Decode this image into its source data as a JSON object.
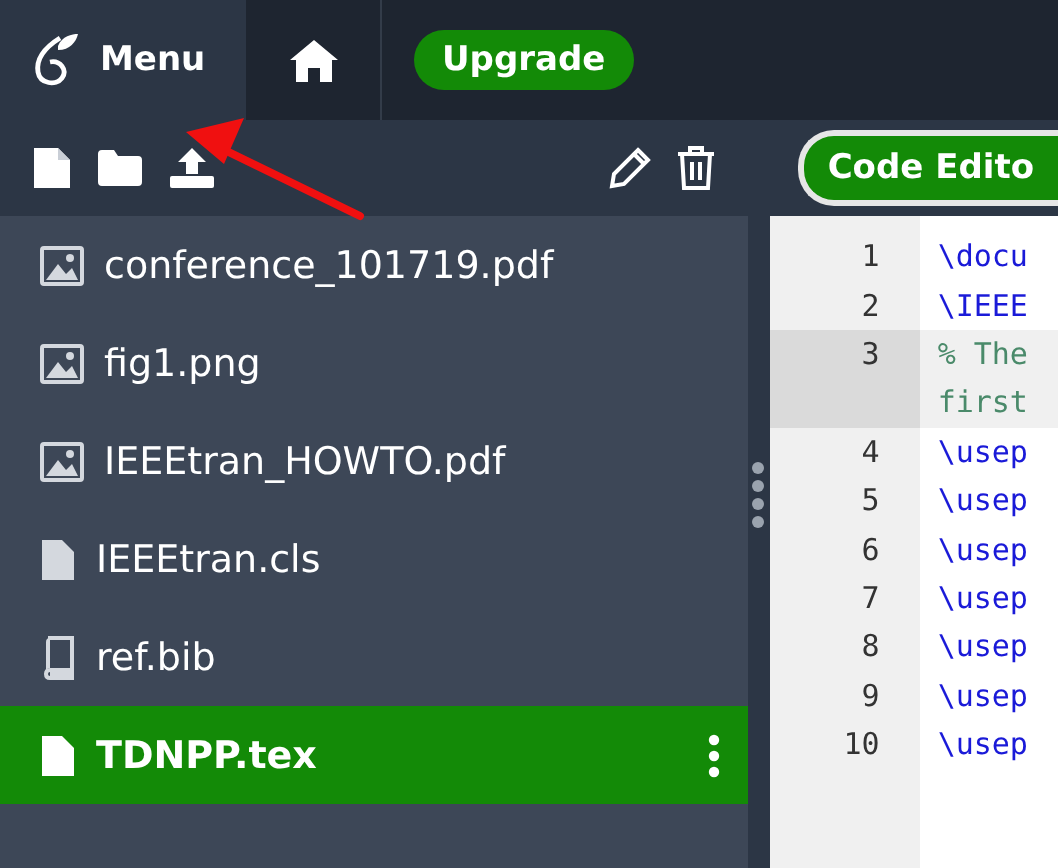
{
  "topbar": {
    "menu_label": "Menu",
    "upgrade_label": "Upgrade"
  },
  "editor_tab": {
    "label": "Code Edito"
  },
  "files": [
    {
      "name": "conference_101719.pdf",
      "kind": "image",
      "selected": false
    },
    {
      "name": "fig1.png",
      "kind": "image",
      "selected": false
    },
    {
      "name": "IEEEtran_HOWTO.pdf",
      "kind": "image",
      "selected": false
    },
    {
      "name": "IEEEtran.cls",
      "kind": "file",
      "selected": false
    },
    {
      "name": "ref.bib",
      "kind": "bib",
      "selected": false
    },
    {
      "name": "TDNPP.tex",
      "kind": "file",
      "selected": true
    }
  ],
  "code_lines": [
    {
      "number": "1",
      "text": "\\docu",
      "kind": "command",
      "active": false
    },
    {
      "number": "2",
      "text": "\\IEEE",
      "kind": "command",
      "active": false
    },
    {
      "number": "3",
      "text": "% The",
      "kind": "comment",
      "active": true
    },
    {
      "text": "first",
      "kind": "comment",
      "active": true
    },
    {
      "number": "4",
      "text": "\\usep",
      "kind": "command",
      "active": false
    },
    {
      "number": "5",
      "text": "\\usep",
      "kind": "command",
      "active": false
    },
    {
      "number": "6",
      "text": "\\usep",
      "kind": "command",
      "active": false
    },
    {
      "number": "7",
      "text": "\\usep",
      "kind": "command",
      "active": false
    },
    {
      "number": "8",
      "text": "\\usep",
      "kind": "command",
      "active": false
    },
    {
      "number": "9",
      "text": "\\usep",
      "kind": "command",
      "active": false
    },
    {
      "number": "10",
      "text": "\\usep",
      "kind": "command",
      "active": false
    }
  ]
}
